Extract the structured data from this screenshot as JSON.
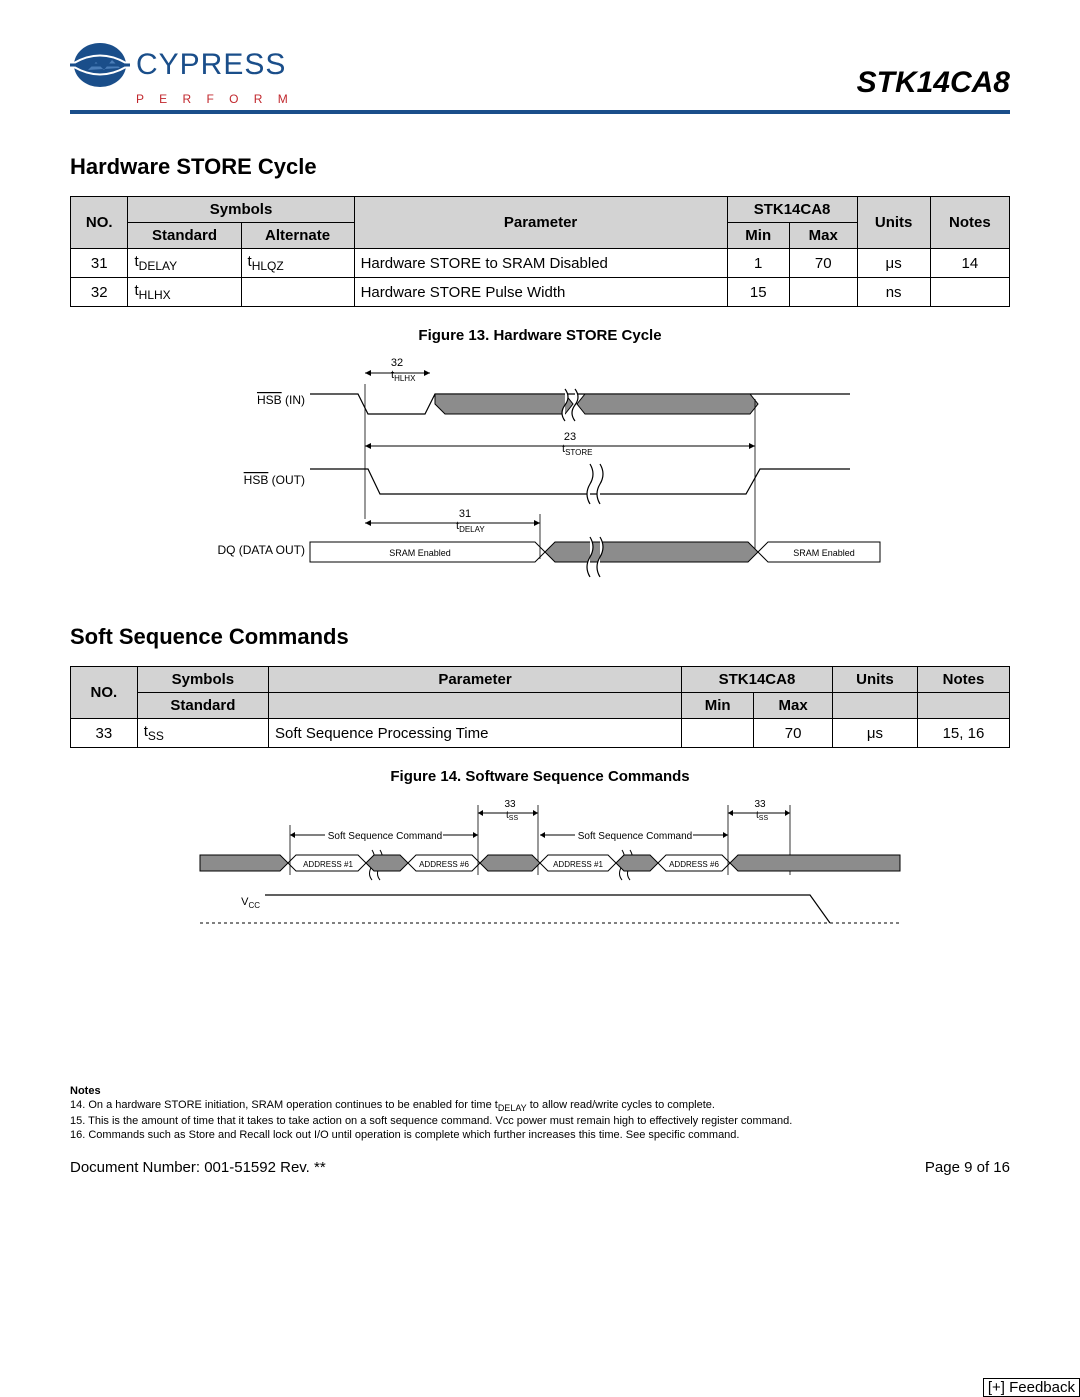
{
  "header": {
    "logo_text": "CYPRESS",
    "logo_sub": "P E R F O R M",
    "part_number": "STK14CA8"
  },
  "section1": {
    "title": "Hardware STORE Cycle",
    "headers": {
      "no": "NO.",
      "symbols": "Symbols",
      "standard": "Standard",
      "alternate": "Alternate",
      "parameter": "Parameter",
      "device": "STK14CA8",
      "min": "Min",
      "max": "Max",
      "units": "Units",
      "notes": "Notes"
    },
    "rows": [
      {
        "no": "31",
        "std_pre": "t",
        "std_sub": "DELAY",
        "alt_pre": "t",
        "alt_sub": "HLQZ",
        "param": "Hardware STORE to SRAM Disabled",
        "min": "1",
        "max": "70",
        "units": "μs",
        "notes": "14"
      },
      {
        "no": "32",
        "std_pre": "t",
        "std_sub": "HLHX",
        "alt_pre": "",
        "alt_sub": "",
        "param": "Hardware STORE Pulse Width",
        "min": "15",
        "max": "",
        "units": "ns",
        "notes": ""
      }
    ],
    "fig_caption": "Figure 13.  Hardware STORE Cycle",
    "fig": {
      "label_32": "32",
      "label_thlhx": "t",
      "label_thlhx_sub": "HLHX",
      "hsb_in": "HSB",
      "hsb_in_suffix": "  (IN)",
      "label_23": "23",
      "label_tstore": "t",
      "label_tstore_sub": "STORE",
      "hsb_out": "HSB",
      "hsb_out_suffix": " (OUT)",
      "label_31": "31",
      "label_tdelay": "t",
      "label_tdelay_sub": "DELAY",
      "dq": "DQ (DATA OUT)",
      "sram_enabled": "SRAM Enabled",
      "sram_enabled2": "SRAM  Enabled"
    }
  },
  "section2": {
    "title": "Soft Sequence Commands",
    "headers": {
      "no": "NO.",
      "symbols": "Symbols",
      "standard": "Standard",
      "parameter": "Parameter",
      "device": "STK14CA8",
      "min": "Min",
      "max": "Max",
      "units": "Units",
      "notes": "Notes"
    },
    "rows": [
      {
        "no": "33",
        "std_pre": "t",
        "std_sub": "SS",
        "param": "Soft Sequence Processing Time",
        "min": "",
        "max": "70",
        "units": "μs",
        "notes": "15, 16"
      }
    ],
    "fig_caption": "Figure 14.  Software Sequence Commands",
    "fig": {
      "label_33": "33",
      "label_tss": "t",
      "label_tss_sub": "SS",
      "soft_seq": "Soft Sequence Command",
      "address": "ADDRESS",
      "addr1": "ADDRESS #1",
      "addr6": "ADDRESS #6",
      "vcc": "V",
      "vcc_sub": "CC"
    }
  },
  "notes": {
    "hdr": "Notes",
    "n14_a": "14. On a hardware STORE initiation, SRAM operation continues to be enabled for time t",
    "n14_sub": "DELAY",
    "n14_b": " to allow read/write cycles to complete.",
    "n15": "15. This is the amount of time that it takes to take action on a soft sequence command. Vcc power must remain high to effectively register command.",
    "n16": "16. Commands such as Store and Recall lock out I/O until operation is complete which further increases this time. See specific command."
  },
  "footer": {
    "doc": "Document Number: 001-51592 Rev. **",
    "page": "Page 9 of 16"
  },
  "feedback": "[+] Feedback"
}
